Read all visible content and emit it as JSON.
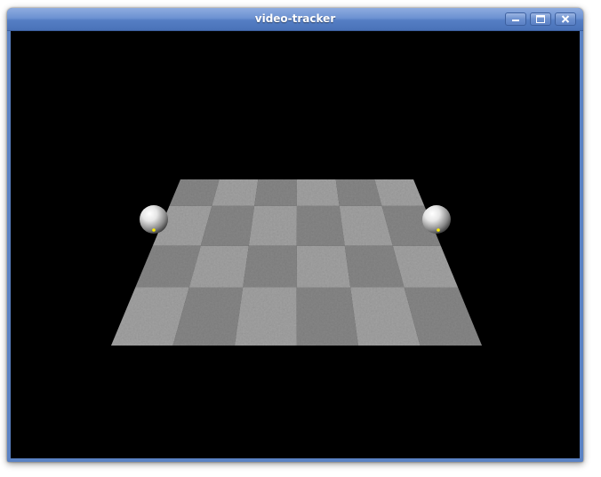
{
  "window": {
    "title": "video-tracker",
    "controls": {
      "minimize_icon": "minimize-icon",
      "maximize_icon": "maximize-icon",
      "close_icon": "close-icon"
    }
  },
  "scene": {
    "background_color": "#000000",
    "floor_tile_colors": [
      "#8a8a8a",
      "#a6a6a6"
    ],
    "floor_grid": {
      "rows": 4,
      "cols": 6
    },
    "marker_color": "#ffee00",
    "spheres": 2
  }
}
